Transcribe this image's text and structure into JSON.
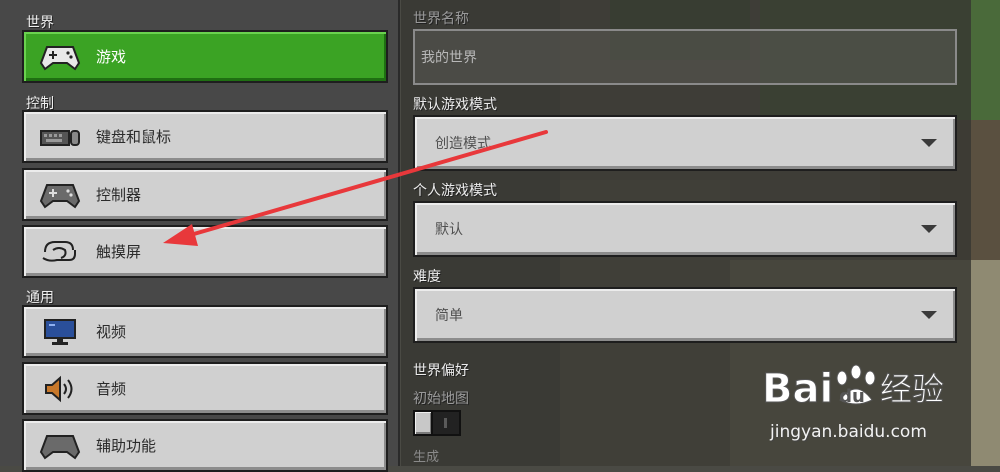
{
  "left_panel": {
    "sections": [
      {
        "label": "世界",
        "items": [
          {
            "label": "游戏",
            "icon": "gamepad-icon",
            "active": true
          }
        ]
      },
      {
        "label": "控制",
        "items": [
          {
            "label": "键盘和鼠标",
            "icon": "keyboard-mouse-icon",
            "active": false
          },
          {
            "label": "控制器",
            "icon": "gamepad-icon",
            "active": false
          },
          {
            "label": "触摸屏",
            "icon": "touch-hand-icon",
            "active": false
          }
        ]
      },
      {
        "label": "通用",
        "items": [
          {
            "label": "视频",
            "icon": "monitor-icon",
            "active": false
          },
          {
            "label": "音频",
            "icon": "speaker-icon",
            "active": false
          },
          {
            "label": "辅助功能",
            "icon": "gamepad-icon",
            "active": false
          }
        ]
      }
    ]
  },
  "right_panel": {
    "world_name": {
      "label": "世界名称",
      "value": "我的世界"
    },
    "default_game_mode": {
      "label": "默认游戏模式",
      "value": "创造模式"
    },
    "personal_game_mode": {
      "label": "个人游戏模式",
      "value": "默认"
    },
    "difficulty": {
      "label": "难度",
      "value": "简单"
    },
    "world_preferences": {
      "label": "世界偏好"
    },
    "starting_map": {
      "label": "初始地图",
      "enabled": false
    },
    "cut_off_label": "生成"
  },
  "watermark": {
    "brand_text": "Baidu经验",
    "url": "jingyan.baidu.com"
  },
  "colors": {
    "active_green": "#3ba324",
    "button_gray": "#d0d0d0",
    "arrow_red": "#e8383b"
  }
}
